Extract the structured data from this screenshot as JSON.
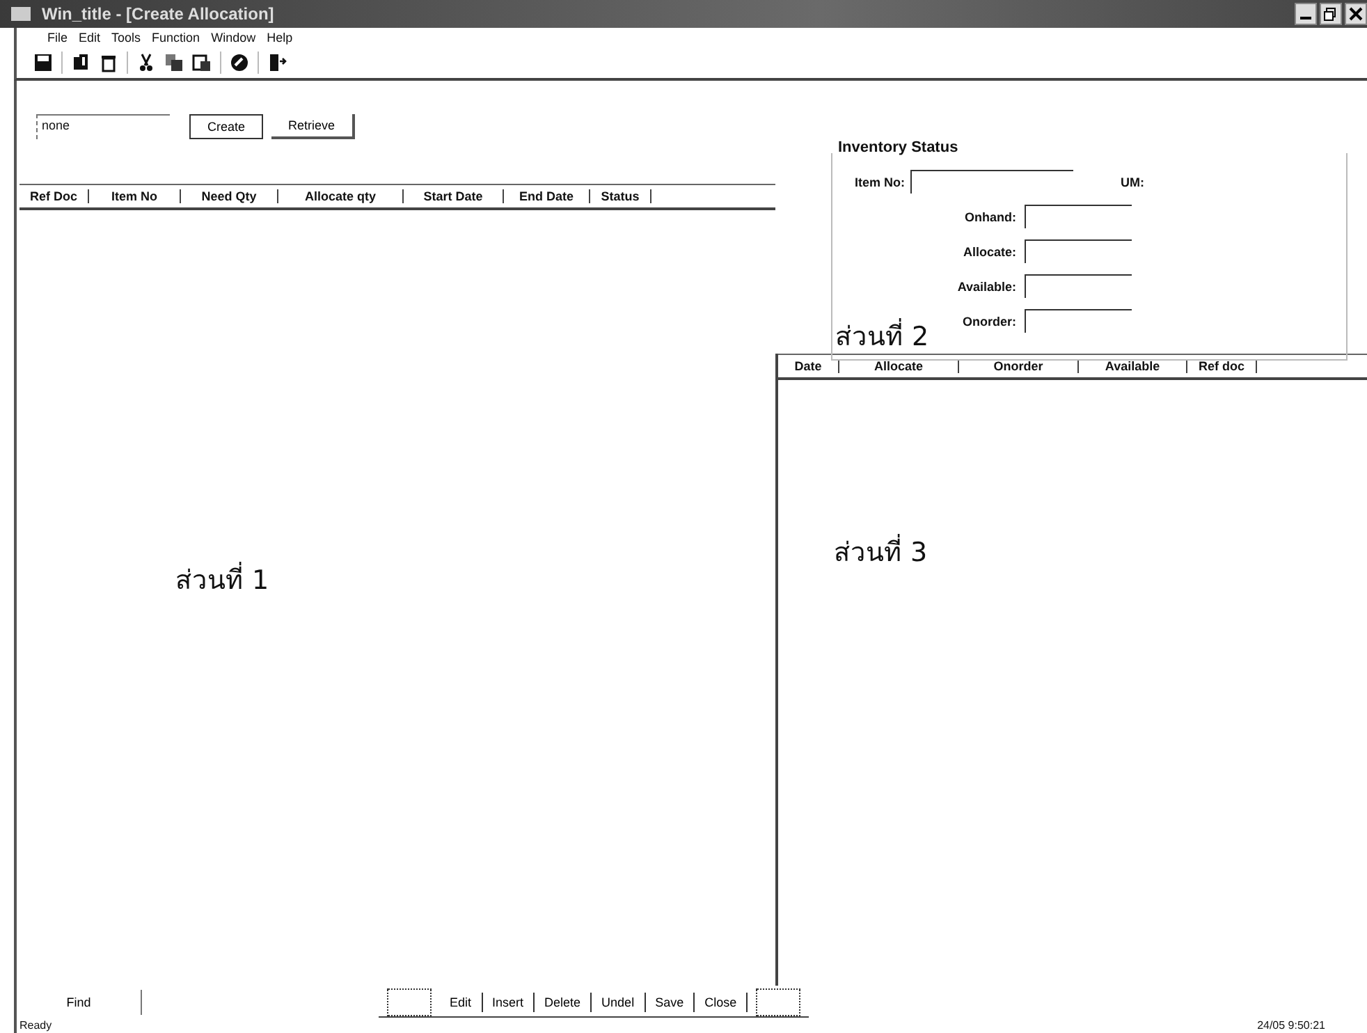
{
  "window": {
    "title": "Win_title - [Create Allocation]"
  },
  "menu": [
    "File",
    "Edit",
    "Tools",
    "Function",
    "Window",
    "Help"
  ],
  "search": {
    "value": "none"
  },
  "top_buttons": [
    "Create",
    "Retrieve"
  ],
  "left_table": {
    "columns": [
      "Ref Doc",
      "Item No",
      "Need Qty",
      "Allocate qty",
      "Start Date",
      "End Date",
      "Status"
    ]
  },
  "section_labels": [
    "ส่วนที่ 1",
    "ส่วนที่ 2",
    "ส่วนที่ 3"
  ],
  "inventory_status": {
    "title": "Inventory Status",
    "item_label": "Item No:",
    "um_label": "UM:",
    "fields": [
      {
        "label": "Onhand:"
      },
      {
        "label": "Allocate:"
      },
      {
        "label": "Available:"
      },
      {
        "label": "Onorder:"
      }
    ]
  },
  "right_table": {
    "columns": [
      "Date",
      "Allocate",
      "Onorder",
      "Available",
      "Ref doc"
    ]
  },
  "find_button": "Find",
  "action_buttons": [
    "Edit",
    "Insert",
    "Delete",
    "Undel",
    "Save",
    "Close"
  ],
  "status_bar": {
    "text": "Ready",
    "datetime": "24/05 9:50:21"
  }
}
